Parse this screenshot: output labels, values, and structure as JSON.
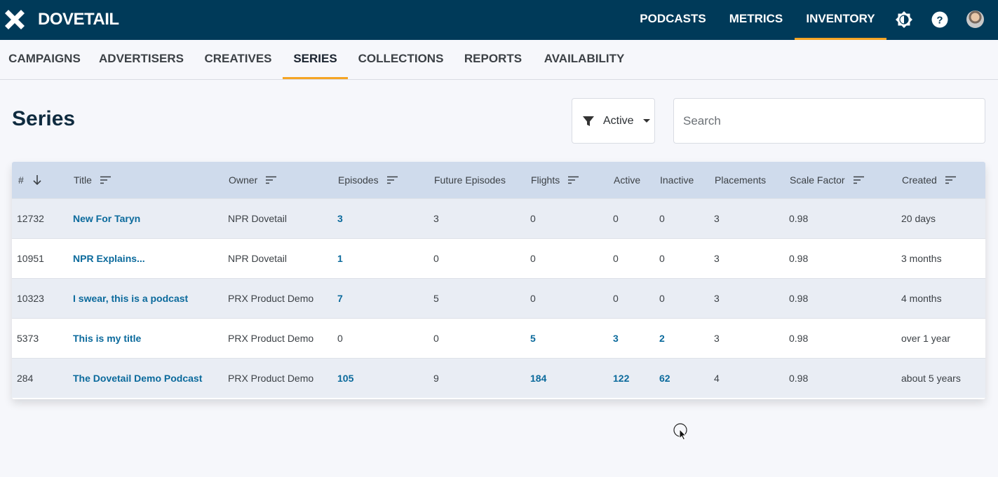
{
  "app": {
    "brand": "DOVETAIL"
  },
  "topnav": [
    {
      "label": "PODCASTS",
      "active": false
    },
    {
      "label": "METRICS",
      "active": false
    },
    {
      "label": "INVENTORY",
      "active": true
    }
  ],
  "topicons": [
    "brightness-icon",
    "help-icon",
    "user-avatar"
  ],
  "subnav": [
    {
      "label": "CAMPAIGNS",
      "active": false
    },
    {
      "label": "ADVERTISERS",
      "active": false
    },
    {
      "label": "CREATIVES",
      "active": false
    },
    {
      "label": "SERIES",
      "active": true
    },
    {
      "label": "COLLECTIONS",
      "active": false
    },
    {
      "label": "REPORTS",
      "active": false
    },
    {
      "label": "AVAILABILITY",
      "active": false
    }
  ],
  "page": {
    "title": "Series",
    "filter_label": "Active",
    "search_placeholder": "Search"
  },
  "table": {
    "columns": [
      {
        "label": "#",
        "sort": "desc"
      },
      {
        "label": "Title",
        "sort": "sortable"
      },
      {
        "label": "Owner",
        "sort": "sortable"
      },
      {
        "label": "Episodes",
        "sort": "sortable"
      },
      {
        "label": "Future Episodes",
        "sort": "none"
      },
      {
        "label": "Flights",
        "sort": "sortable"
      },
      {
        "label": "Active",
        "sort": "none"
      },
      {
        "label": "Inactive",
        "sort": "none"
      },
      {
        "label": "Placements",
        "sort": "none"
      },
      {
        "label": "Scale Factor",
        "sort": "sortable"
      },
      {
        "label": "Created",
        "sort": "sortable"
      }
    ],
    "rows": [
      {
        "id": "12732",
        "title": "New For Taryn",
        "owner": "NPR Dovetail",
        "episodes": "3",
        "future": "3",
        "flights": "0",
        "active": "0",
        "inactive": "0",
        "placements": "3",
        "scale": "0.98",
        "created": "20 days"
      },
      {
        "id": "10951",
        "title": "NPR Explains...",
        "owner": "NPR Dovetail",
        "episodes": "1",
        "future": "0",
        "flights": "0",
        "active": "0",
        "inactive": "0",
        "placements": "3",
        "scale": "0.98",
        "created": "3 months"
      },
      {
        "id": "10323",
        "title": "I swear, this is a podcast",
        "owner": "PRX Product Demo",
        "episodes": "7",
        "future": "5",
        "flights": "0",
        "active": "0",
        "inactive": "0",
        "placements": "3",
        "scale": "0.98",
        "created": "4 months"
      },
      {
        "id": "5373",
        "title": "This is my title",
        "owner": "PRX Product Demo",
        "episodes": "0",
        "future": "0",
        "flights": "5",
        "active": "3",
        "inactive": "2",
        "placements": "3",
        "scale": "0.98",
        "created": "over 1 year"
      },
      {
        "id": "284",
        "title": "The Dovetail Demo Podcast",
        "owner": "PRX Product Demo",
        "episodes": "105",
        "future": "9",
        "flights": "184",
        "active": "122",
        "inactive": "62",
        "placements": "4",
        "scale": "0.98",
        "created": "about 5 years"
      }
    ]
  },
  "colors": {
    "topbar": "#003a59",
    "accent": "#f5a524",
    "link": "#0b6a9c",
    "header_row": "#cfdbec"
  }
}
